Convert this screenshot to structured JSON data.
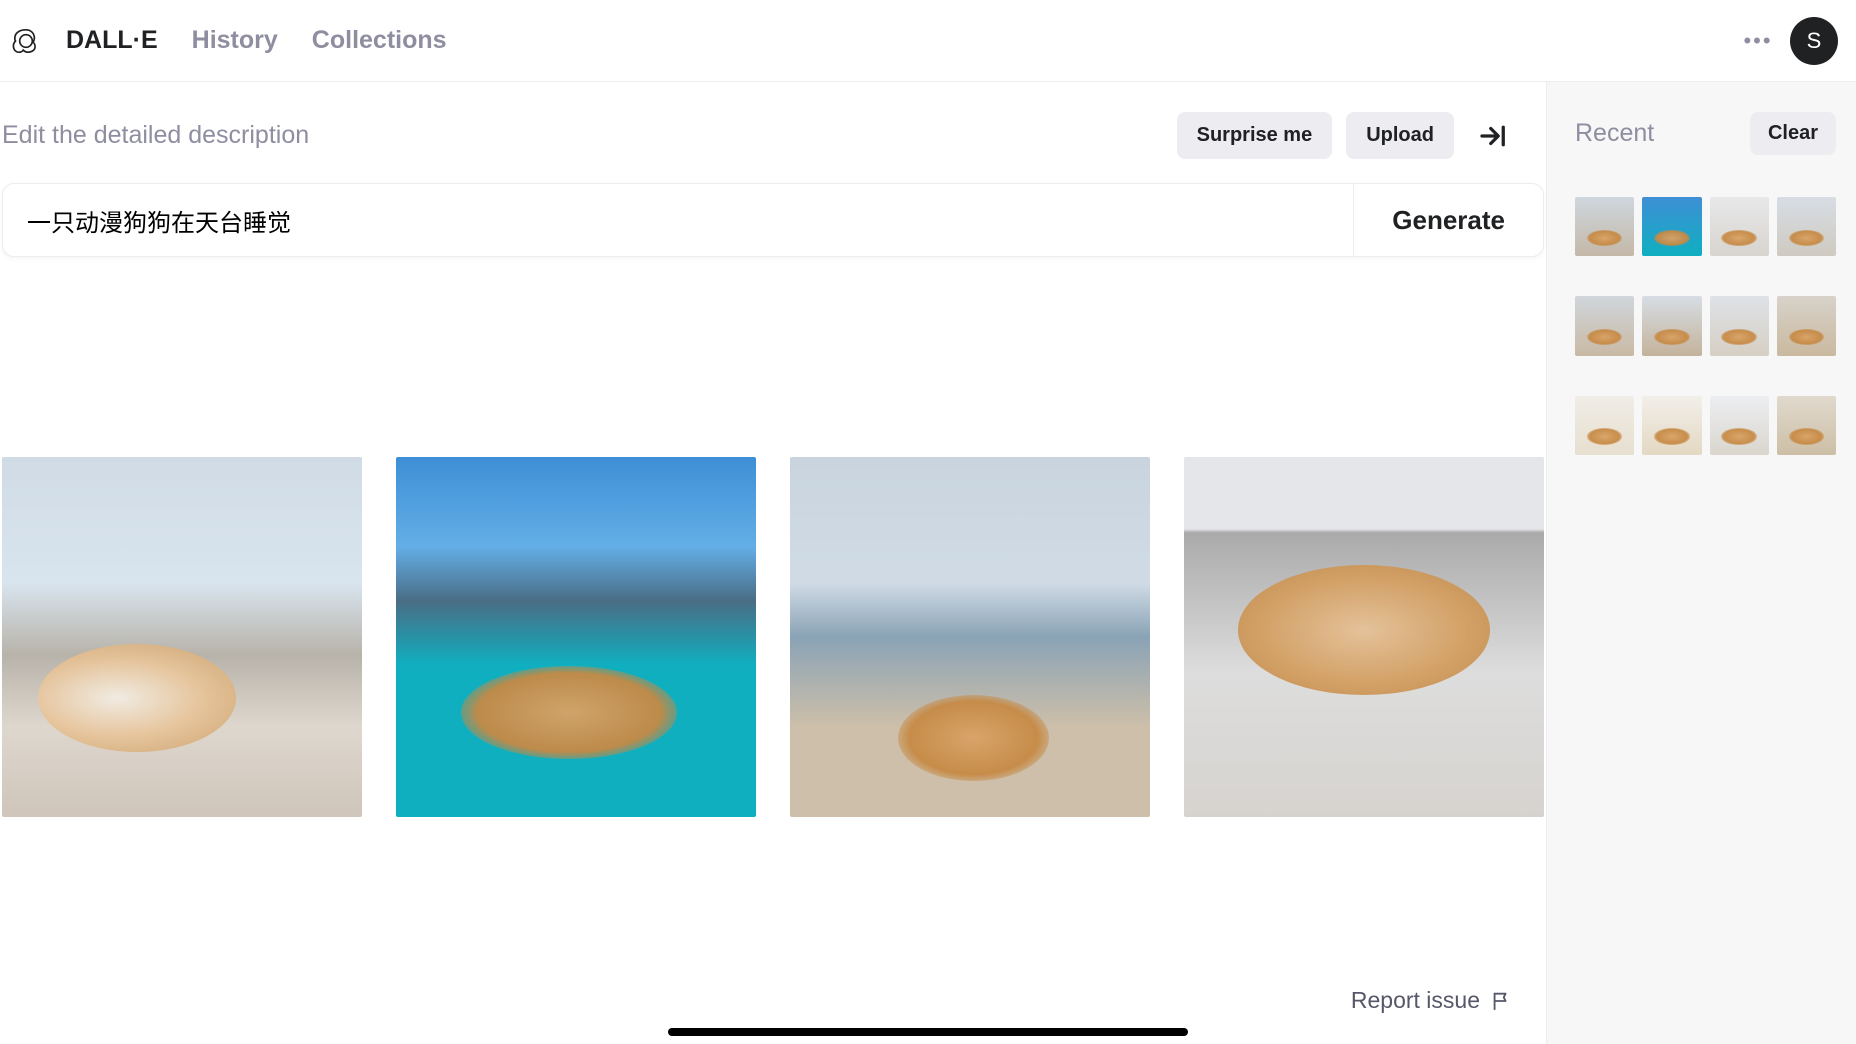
{
  "nav": {
    "brand": "DALL·E",
    "history": "History",
    "collections": "Collections"
  },
  "avatar_initial": "S",
  "subheader": "Edit the detailed description",
  "buttons": {
    "surprise": "Surprise me",
    "upload": "Upload",
    "generate": "Generate",
    "clear": "Clear"
  },
  "prompt_value": "一只动漫狗狗在天台睡觉",
  "report_label": "Report issue",
  "sidebar_title": "Recent",
  "results_count": 4,
  "recent_groups": 3,
  "recent_per_group": 4
}
